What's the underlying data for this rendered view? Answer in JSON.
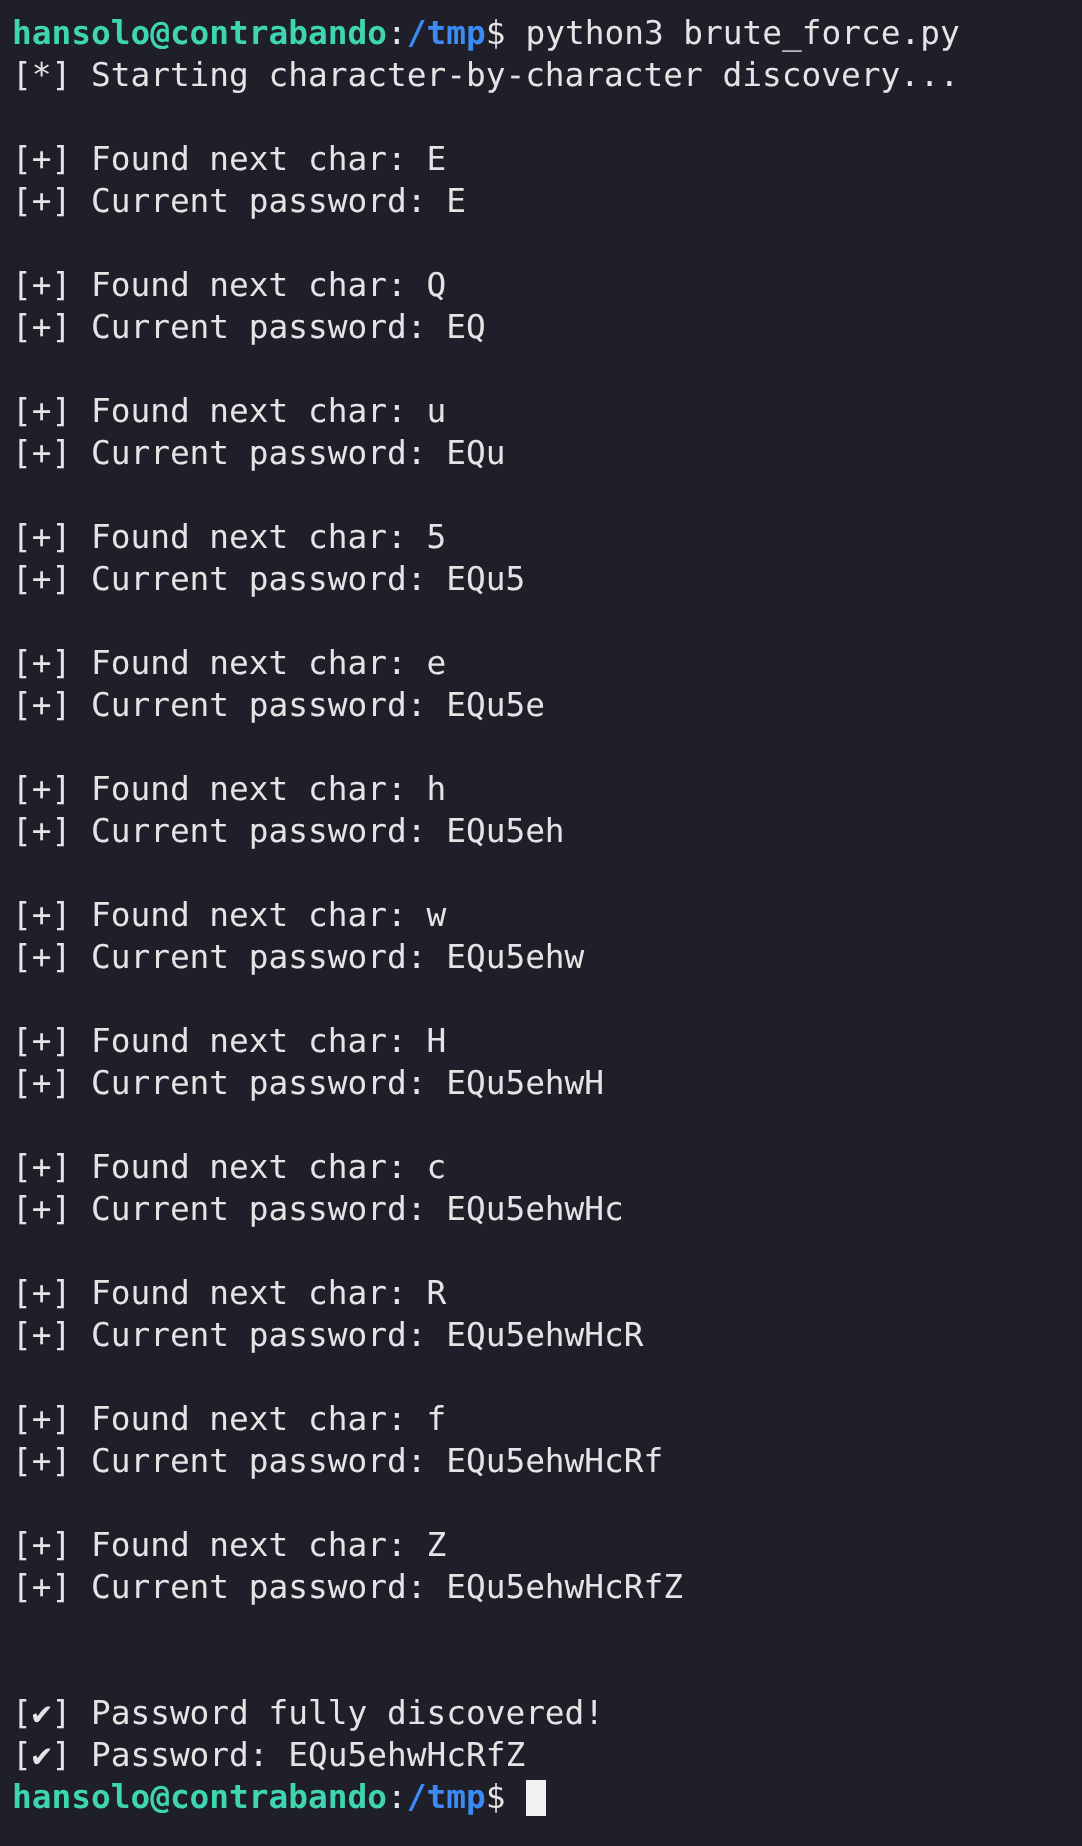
{
  "lines": [
    {
      "kind": "prompt",
      "user_host": "hansolo@contrabando",
      "separator": ":",
      "path": "/tmp",
      "symbol": "$",
      "command": "python3 brute_force.py"
    },
    {
      "kind": "output",
      "text": "[*] Starting character-by-character discovery..."
    },
    {
      "kind": "blank"
    },
    {
      "kind": "output",
      "text": "[+] Found next char: E"
    },
    {
      "kind": "output",
      "text": "[+] Current password: E"
    },
    {
      "kind": "blank"
    },
    {
      "kind": "output",
      "text": "[+] Found next char: Q"
    },
    {
      "kind": "output",
      "text": "[+] Current password: EQ"
    },
    {
      "kind": "blank"
    },
    {
      "kind": "output",
      "text": "[+] Found next char: u"
    },
    {
      "kind": "output",
      "text": "[+] Current password: EQu"
    },
    {
      "kind": "blank"
    },
    {
      "kind": "output",
      "text": "[+] Found next char: 5"
    },
    {
      "kind": "output",
      "text": "[+] Current password: EQu5"
    },
    {
      "kind": "blank"
    },
    {
      "kind": "output",
      "text": "[+] Found next char: e"
    },
    {
      "kind": "output",
      "text": "[+] Current password: EQu5e"
    },
    {
      "kind": "blank"
    },
    {
      "kind": "output",
      "text": "[+] Found next char: h"
    },
    {
      "kind": "output",
      "text": "[+] Current password: EQu5eh"
    },
    {
      "kind": "blank"
    },
    {
      "kind": "output",
      "text": "[+] Found next char: w"
    },
    {
      "kind": "output",
      "text": "[+] Current password: EQu5ehw"
    },
    {
      "kind": "blank"
    },
    {
      "kind": "output",
      "text": "[+] Found next char: H"
    },
    {
      "kind": "output",
      "text": "[+] Current password: EQu5ehwH"
    },
    {
      "kind": "blank"
    },
    {
      "kind": "output",
      "text": "[+] Found next char: c"
    },
    {
      "kind": "output",
      "text": "[+] Current password: EQu5ehwHc"
    },
    {
      "kind": "blank"
    },
    {
      "kind": "output",
      "text": "[+] Found next char: R"
    },
    {
      "kind": "output",
      "text": "[+] Current password: EQu5ehwHcR"
    },
    {
      "kind": "blank"
    },
    {
      "kind": "output",
      "text": "[+] Found next char: f"
    },
    {
      "kind": "output",
      "text": "[+] Current password: EQu5ehwHcRf"
    },
    {
      "kind": "blank"
    },
    {
      "kind": "output",
      "text": "[+] Found next char: Z"
    },
    {
      "kind": "output",
      "text": "[+] Current password: EQu5ehwHcRfZ"
    },
    {
      "kind": "blank"
    },
    {
      "kind": "blank"
    },
    {
      "kind": "output",
      "text": "[✔] Password fully discovered!"
    },
    {
      "kind": "output",
      "text": "[✔] Password: EQu5ehwHcRfZ"
    },
    {
      "kind": "prompt",
      "user_host": "hansolo@contrabando",
      "separator": ":",
      "path": "/tmp",
      "symbol": "$",
      "cursor": true
    }
  ]
}
